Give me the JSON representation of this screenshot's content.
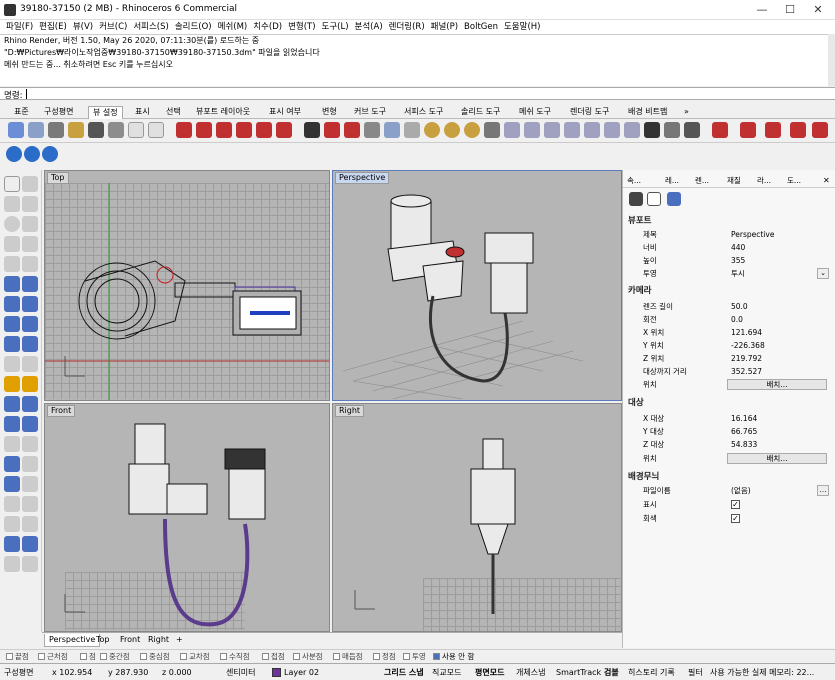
{
  "window": {
    "title": "39180-37150 (2 MB) - Rhinoceros 6 Commercial",
    "minimize": "—",
    "maximize": "☐",
    "close": "✕"
  },
  "menu": [
    "파일(F)",
    "편집(E)",
    "뷰(V)",
    "커브(C)",
    "서피스(S)",
    "솔리드(O)",
    "메쉬(M)",
    "치수(D)",
    "변형(T)",
    "도구(L)",
    "분석(A)",
    "렌더링(R)",
    "패널(P)",
    "BoltGen",
    "도움말(H)"
  ],
  "command_history": [
    "Rhino Render, 버전 1.50, May 26 2020, 07:11:30분(를) 로드하는 중",
    "\"D:₩Pictures₩라이노작업중₩39180-37150₩39180-37150.3dm\" 파일을 읽었습니다",
    "메쉬 만드는 중... 취소하려면 Esc 키를 누르십시오"
  ],
  "command_prompt": "명령:",
  "toolbar_tabs": [
    "표준",
    "구성평면",
    "뷰 설정",
    "표시",
    "선택",
    "뷰포트 레이아웃",
    "표시 여부",
    "변형",
    "커브 도구",
    "서피스 도구",
    "솔리드 도구",
    "메쉬 도구",
    "렌더링 도구",
    "배경 비트맵",
    "»"
  ],
  "active_toolbar_tab": "뷰 설정",
  "viewports": {
    "top": {
      "label": "Top"
    },
    "perspective": {
      "label": "Perspective"
    },
    "front": {
      "label": "Front"
    },
    "right": {
      "label": "Right"
    }
  },
  "viewport_tabs": [
    "Perspective",
    "Top",
    "Front",
    "Right",
    "+"
  ],
  "osnap": [
    "끝점",
    "근처점",
    "점",
    "중간점",
    "중심점",
    "교차점",
    "수직점",
    "접점",
    "사분점",
    "매듭점",
    "정점",
    "투영",
    "사용 안 함"
  ],
  "status": {
    "cplane": "구성평면",
    "x": "x 102.954",
    "y": "y 287.930",
    "z": "z 0.000",
    "units": "센티미터",
    "layer": "Layer 02",
    "layer_color": "#7030a0",
    "toggles": [
      "그리드 스냅",
      "직교모드",
      "평면모드",
      "개체스냅",
      "SmartTrack",
      "검볼",
      "히스토리 기록",
      "필터",
      "사용 가능한 실제 메모리: 22..."
    ]
  },
  "panel": {
    "tabs": [
      "속...",
      "레...",
      "렌...",
      "재질",
      "라...",
      "도..."
    ],
    "viewport_section": "뷰포트",
    "viewport_rows": [
      {
        "k": "제목",
        "v": "Perspective"
      },
      {
        "k": "너비",
        "v": "440"
      },
      {
        "k": "높이",
        "v": "355"
      },
      {
        "k": "투영",
        "v": "투시"
      }
    ],
    "camera_section": "카메라",
    "camera_rows": [
      {
        "k": "렌즈 길이",
        "v": "50.0"
      },
      {
        "k": "회전",
        "v": "0.0"
      },
      {
        "k": "X 위치",
        "v": "121.694"
      },
      {
        "k": "Y 위치",
        "v": "-226.368"
      },
      {
        "k": "Z 위치",
        "v": "219.792"
      },
      {
        "k": "대상까지 거리",
        "v": "352.527"
      }
    ],
    "camera_location_label": "위치",
    "place_button": "배치...",
    "target_section": "대상",
    "target_rows": [
      {
        "k": "X 대상",
        "v": "16.164"
      },
      {
        "k": "Y 대상",
        "v": "66.765"
      },
      {
        "k": "Z 대상",
        "v": "54.833"
      }
    ],
    "target_location_label": "위치",
    "wallpaper_section": "배경무늬",
    "wallpaper_rows": [
      {
        "k": "파일이름",
        "v": "(없음)"
      },
      {
        "k": "표시",
        "v": "✓"
      },
      {
        "k": "회색",
        "v": "✓"
      }
    ]
  }
}
